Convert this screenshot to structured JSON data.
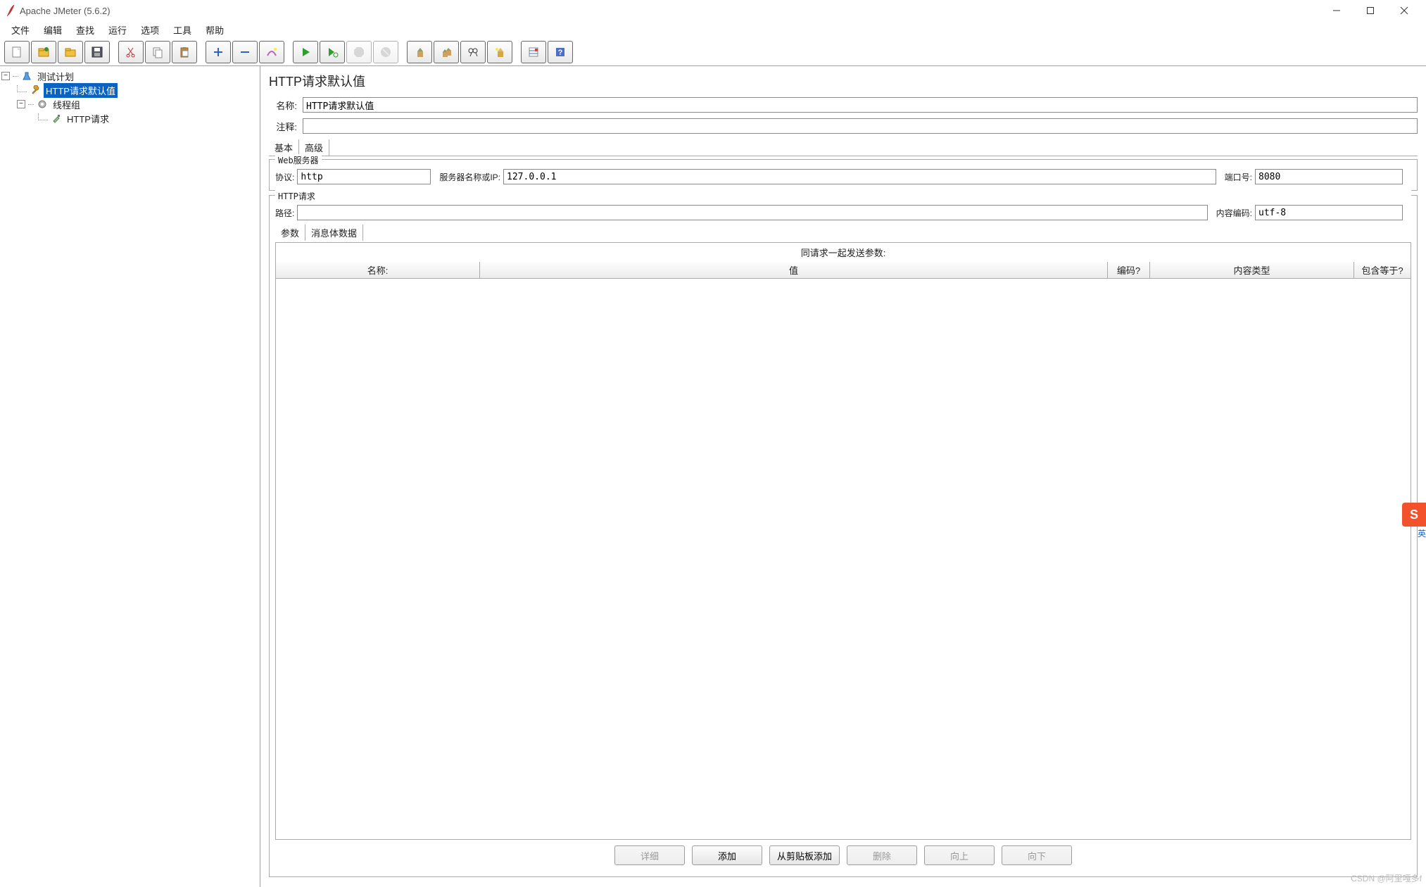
{
  "window": {
    "title": "Apache JMeter (5.6.2)"
  },
  "menu": {
    "items": [
      "文件",
      "编辑",
      "查找",
      "运行",
      "选项",
      "工具",
      "帮助"
    ]
  },
  "toolbar": {
    "buttons": [
      {
        "name": "new-icon"
      },
      {
        "name": "open-templates-icon"
      },
      {
        "name": "open-icon"
      },
      {
        "name": "save-icon"
      },
      {
        "name": "sep"
      },
      {
        "name": "cut-icon"
      },
      {
        "name": "copy-icon"
      },
      {
        "name": "paste-icon"
      },
      {
        "name": "sep"
      },
      {
        "name": "expand-icon"
      },
      {
        "name": "collapse-icon"
      },
      {
        "name": "toggle-icon"
      },
      {
        "name": "sep"
      },
      {
        "name": "start-icon"
      },
      {
        "name": "start-no-timers-icon"
      },
      {
        "name": "stop-icon",
        "disabled": true
      },
      {
        "name": "shutdown-icon",
        "disabled": true
      },
      {
        "name": "sep"
      },
      {
        "name": "clear-icon"
      },
      {
        "name": "clear-all-icon"
      },
      {
        "name": "search-icon"
      },
      {
        "name": "reset-search-icon"
      },
      {
        "name": "sep"
      },
      {
        "name": "function-helper-icon"
      },
      {
        "name": "help-icon"
      }
    ]
  },
  "tree": {
    "root": {
      "label": "测试计划"
    },
    "httpDefaults": {
      "label": "HTTP请求默认值"
    },
    "threadGroup": {
      "label": "线程组"
    },
    "httpRequest": {
      "label": "HTTP请求"
    }
  },
  "panel": {
    "title": "HTTP请求默认值",
    "nameLabel": "名称:",
    "nameValue": "HTTP请求默认值",
    "commentLabel": "注释:",
    "commentValue": "",
    "tabBasic": "基本",
    "tabAdvanced": "高级",
    "webserver": {
      "legend": "Web服务器",
      "protocolLabel": "协议:",
      "protocolValue": "http",
      "serverLabel": "服务器名称或IP:",
      "serverValue": "127.0.0.1",
      "portLabel": "端口号:",
      "portValue": "8080"
    },
    "httpreq": {
      "legend": "HTTP请求",
      "pathLabel": "路径:",
      "pathValue": "",
      "encodingLabel": "内容编码:",
      "encodingValue": "utf-8"
    },
    "paramTabs": {
      "params": "参数",
      "body": "消息体数据"
    },
    "paramHeader": "同请求一起发送参数:",
    "columns": {
      "name": "名称:",
      "value": "值",
      "encode": "编码?",
      "contentType": "内容类型",
      "includeEquals": "包含等于?"
    },
    "buttons": {
      "detail": "详细",
      "add": "添加",
      "fromClipboard": "从剪贴板添加",
      "delete": "删除",
      "up": "向上",
      "down": "向下"
    }
  },
  "watermark": "CSDN @阿里嘎多f",
  "ime": {
    "sub": "英"
  }
}
